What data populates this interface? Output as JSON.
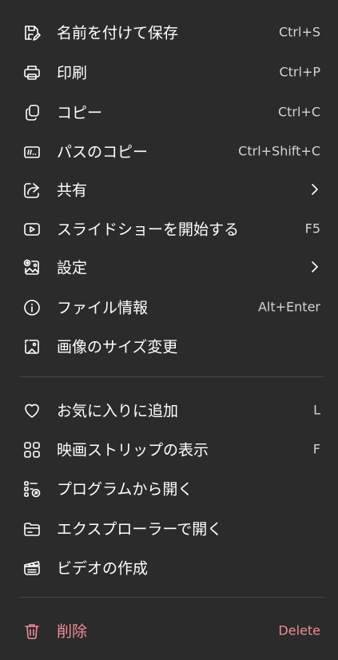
{
  "menu": {
    "items": [
      {
        "label": "名前を付けて保存",
        "shortcut": "Ctrl+S",
        "icon": "save-as-icon"
      },
      {
        "label": "印刷",
        "shortcut": "Ctrl+P",
        "icon": "print-icon"
      },
      {
        "label": "コピー",
        "shortcut": "Ctrl+C",
        "icon": "copy-icon"
      },
      {
        "label": "パスのコピー",
        "shortcut": "Ctrl+Shift+C",
        "icon": "copy-path-icon"
      },
      {
        "label": "共有",
        "shortcut": "",
        "icon": "share-icon",
        "submenu": true
      },
      {
        "label": "スライドショーを開始する",
        "shortcut": "F5",
        "icon": "slideshow-icon"
      },
      {
        "label": "設定",
        "shortcut": "",
        "icon": "set-as-icon",
        "submenu": true
      },
      {
        "label": "ファイル情報",
        "shortcut": "Alt+Enter",
        "icon": "info-icon"
      },
      {
        "label": "画像のサイズ変更",
        "shortcut": "",
        "icon": "resize-image-icon"
      },
      {
        "label": "お気に入りに追加",
        "shortcut": "L",
        "icon": "heart-icon"
      },
      {
        "label": "映画ストリップの表示",
        "shortcut": "F",
        "icon": "filmstrip-icon"
      },
      {
        "label": "プログラムから開く",
        "shortcut": "",
        "icon": "open-with-icon"
      },
      {
        "label": "エクスプローラーで開く",
        "shortcut": "",
        "icon": "folder-icon"
      },
      {
        "label": "ビデオの作成",
        "shortcut": "",
        "icon": "video-icon"
      },
      {
        "label": "削除",
        "shortcut": "Delete",
        "icon": "trash-icon",
        "danger": true
      }
    ]
  },
  "colors": {
    "background": "#2b2b2b",
    "text": "#ffffff",
    "shortcut": "#d4d4d4",
    "danger": "#f28b99",
    "divider": "#454545"
  }
}
